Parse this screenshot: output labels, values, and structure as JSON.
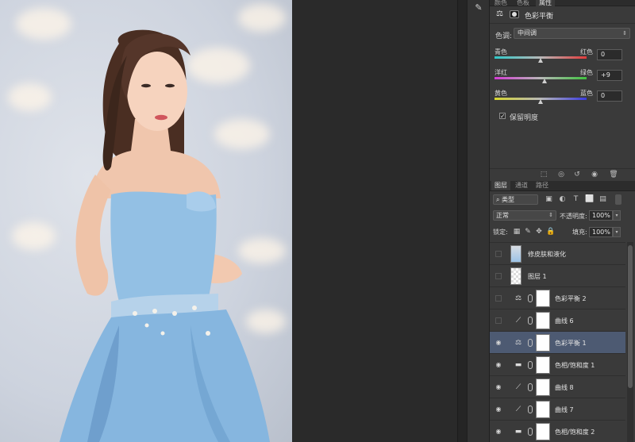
{
  "panel_tabs": [
    "颜色",
    "色板",
    "属性"
  ],
  "properties": {
    "title": "色彩平衡",
    "tone_label": "色调:",
    "tone_value": "中间调",
    "sliders": [
      {
        "left": "青色",
        "right": "红色",
        "value": "0",
        "gradient": [
          "#2fc7c7",
          "#b8b8b8",
          "#e23b3b"
        ],
        "position": 0.5
      },
      {
        "left": "洋红",
        "right": "绿色",
        "value": "+9",
        "gradient": [
          "#d43cd4",
          "#b8b8b8",
          "#3fc23f"
        ],
        "position": 0.54
      },
      {
        "left": "黄色",
        "right": "蓝色",
        "value": "0",
        "gradient": [
          "#d6d62e",
          "#b8b8b8",
          "#3a3ae0"
        ],
        "position": 0.5
      }
    ],
    "preserve_luminosity": "保留明度",
    "preserve_checked": true
  },
  "layers_panel": {
    "tabs": [
      "图层",
      "通道",
      "路径"
    ],
    "filter_value": "类型",
    "blend_mode": "正常",
    "opacity_label": "不透明度:",
    "opacity_value": "100%",
    "lock_label": "锁定:",
    "fill_label": "填充:",
    "fill_value": "100%",
    "layers": [
      {
        "name": "修皮肤和液化",
        "visible": false,
        "kind": "pixel",
        "selected": false,
        "icon": "photo-thumbnail"
      },
      {
        "name": "图层 1",
        "visible": false,
        "kind": "pixel",
        "selected": false,
        "icon": "transparent-thumbnail"
      },
      {
        "name": "色彩平衡 2",
        "visible": false,
        "kind": "adjust",
        "selected": false,
        "icon": "balance-icon"
      },
      {
        "name": "曲线 6",
        "visible": false,
        "kind": "adjust",
        "selected": false,
        "icon": "curves-icon"
      },
      {
        "name": "色彩平衡 1",
        "visible": true,
        "kind": "adjust",
        "selected": true,
        "icon": "balance-icon"
      },
      {
        "name": "色相/饱和度 1",
        "visible": true,
        "kind": "adjust",
        "selected": false,
        "icon": "hue-saturation-icon"
      },
      {
        "name": "曲线 8",
        "visible": true,
        "kind": "adjust",
        "selected": false,
        "icon": "curves-icon"
      },
      {
        "name": "曲线 7",
        "visible": true,
        "kind": "adjust",
        "selected": false,
        "icon": "curves-icon"
      },
      {
        "name": "色相/饱和度 2",
        "visible": true,
        "kind": "adjust",
        "selected": false,
        "icon": "hue-saturation-icon"
      }
    ]
  },
  "colors": {
    "panel_bg": "#3a3a3a",
    "selected_layer": "#4d5a72",
    "dress": "#8fbde3"
  }
}
